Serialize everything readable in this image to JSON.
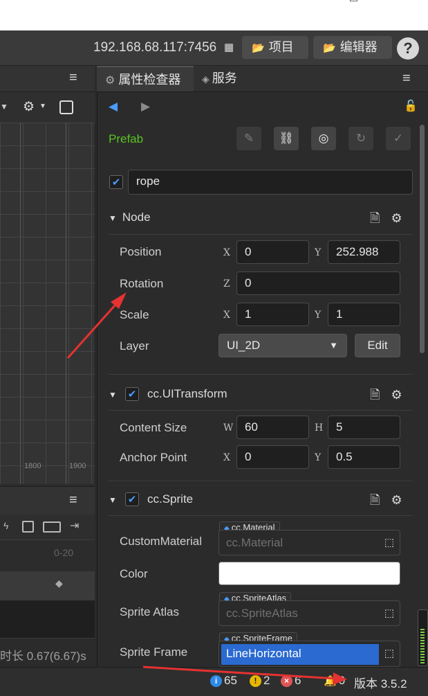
{
  "window": {
    "minimize_icon": "□",
    "close_icon": "×"
  },
  "toolbar": {
    "address": "192.168.68.117:7456",
    "project_label": "项目",
    "editor_label": "编辑器",
    "help_label": "?"
  },
  "scene": {
    "grid_labels": [
      "1800",
      "1900"
    ]
  },
  "animation": {
    "range": "0-20",
    "duration": "时长 0.67(6.67)s"
  },
  "inspector": {
    "tabs": [
      {
        "label": "属性检查器"
      },
      {
        "label": "服务"
      }
    ],
    "prefab_label": "Prefab",
    "node_name": "rope",
    "node": {
      "title": "Node",
      "position_label": "Position",
      "position_x": "0",
      "position_y": "252.988",
      "rotation_label": "Rotation",
      "rotation_z": "0",
      "scale_label": "Scale",
      "scale_x": "1",
      "scale_y": "1",
      "layer_label": "Layer",
      "layer_value": "UI_2D",
      "edit_label": "Edit"
    },
    "uitransform": {
      "title": "cc.UITransform",
      "content_size_label": "Content Size",
      "width": "60",
      "height": "5",
      "anchor_label": "Anchor Point",
      "anchor_x": "0",
      "anchor_y": "0.5"
    },
    "sprite": {
      "title": "cc.Sprite",
      "material_label": "CustomMaterial",
      "material_tag": "cc.Material",
      "material_placeholder": "cc.Material",
      "color_label": "Color",
      "color_value": "#ffffff",
      "atlas_label": "Sprite Atlas",
      "atlas_tag": "cc.SpriteAtlas",
      "atlas_placeholder": "cc.SpriteAtlas",
      "frame_label": "Sprite Frame",
      "frame_tag": "cc.SpriteFrame",
      "frame_value": "LineHorizontal"
    },
    "axes": {
      "x": "X",
      "y": "Y",
      "z": "Z",
      "w": "W",
      "h": "H"
    }
  },
  "status": {
    "info_count": "65",
    "warn_count": "2",
    "error_count": "6",
    "notify_count": "0",
    "version": "版本 3.5.2"
  },
  "colors": {
    "accent": "#4a9cff",
    "prefab_green": "#58c322",
    "annotation_red": "#e53232"
  }
}
